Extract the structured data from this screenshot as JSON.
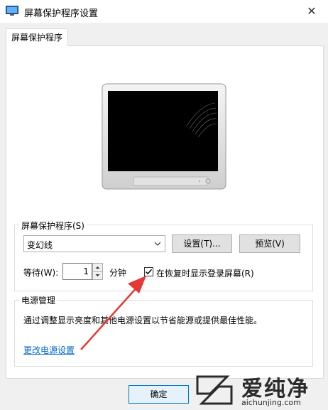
{
  "window": {
    "title": "屏幕保护程序设置",
    "close_symbol": "✕"
  },
  "tab": {
    "label": "屏幕保护程序"
  },
  "screensaver": {
    "group_label": "屏幕保护程序(S)",
    "selected": "变幻线",
    "settings_button": "设置(T)...",
    "preview_button": "预览(V)",
    "wait_label": "等待(W):",
    "wait_value": "1",
    "minutes_label": "分钟",
    "resume_checkbox_label": "在恢复时显示登录屏幕(R)",
    "resume_checked": true
  },
  "power": {
    "group_label": "电源管理",
    "description": "通过调整显示亮度和其他电源设置以节省能源或提供最佳性能。",
    "link": "更改电源设置"
  },
  "footer": {
    "ok_button": "确定"
  },
  "watermark": {
    "title": "爱纯净",
    "url": "aichunjing.com"
  },
  "colors": {
    "accent": "#0078d7",
    "link": "#0066cc",
    "annotation_arrow": "#e53935"
  }
}
